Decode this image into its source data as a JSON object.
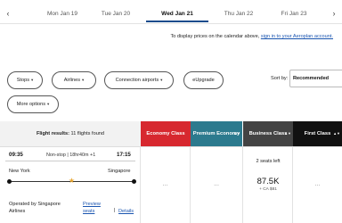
{
  "date_bar": {
    "prev_arrow": "‹",
    "next_arrow": "›",
    "dates": [
      {
        "label": "Mon Jan 19"
      },
      {
        "label": "Tue Jan 20"
      },
      {
        "label": "Wed Jan 21"
      },
      {
        "label": "Thu Jan 22"
      },
      {
        "label": "Fri Jan 23"
      }
    ],
    "active_index": 2
  },
  "prices_note": {
    "text": "To display prices on the calendar above, ",
    "link": "sign in to your Aeroplan account."
  },
  "filters": {
    "stops": "Stops",
    "airlines": "Airlines",
    "connection_airports": "Connection airports",
    "eupgrade": "eUpgrade",
    "more_options": "More options",
    "chevron": "▾"
  },
  "sort": {
    "label": "Sort by:",
    "value": "Recommended"
  },
  "results": {
    "prefix": "Flight results:",
    "count_text": "11 flights found"
  },
  "cabins": [
    {
      "label": "Economy Class",
      "color": "#d7282f"
    },
    {
      "label": "Premium Economy",
      "color": "#2c7a8e"
    },
    {
      "label": "Business Class",
      "color": "#434343"
    },
    {
      "label": "First Class",
      "color": "#111111"
    }
  ],
  "flight": {
    "depart_time": "09:35",
    "stops_duration": "Non-stop | 18hr40m +1",
    "arrive_time": "17:15",
    "origin": "New York",
    "destination": "Singapore",
    "operated_by": "Operated by Singapore Airlines",
    "preview_seats": "Preview seats",
    "details": "Details",
    "pipe": "|",
    "economy": "...",
    "premium_economy": "...",
    "business": {
      "seats_left": "2 seats left",
      "points": "87.5K",
      "cash": "+ CA $81"
    },
    "first": "..."
  },
  "colors": {
    "accent_blue": "#1a55b0",
    "stop_marker": "#e8a630"
  }
}
